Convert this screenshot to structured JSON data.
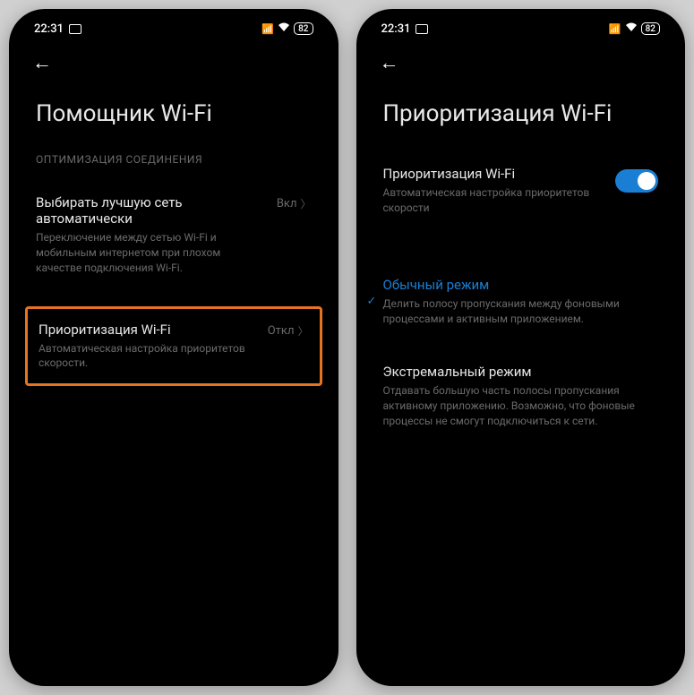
{
  "statusbar": {
    "time": "22:31",
    "battery": "82"
  },
  "left_phone": {
    "title": "Помощник Wi-Fi",
    "section": "ОПТИМИЗАЦИЯ СОЕДИНЕНИЯ",
    "item1": {
      "title": "Выбирать лучшую сеть автоматически",
      "desc": "Переключение между сетью Wi-Fi и мобильным интернетом при плохом качестве подключения Wi-Fi.",
      "value": "Вкл"
    },
    "item2": {
      "title": "Приоритизация Wi-Fi",
      "desc": "Автоматическая настройка приоритетов скорости.",
      "value": "Откл"
    }
  },
  "right_phone": {
    "title": "Приоритизация Wi-Fi",
    "toggle_item": {
      "title": "Приоритизация Wi-Fi",
      "desc": "Автоматическая настройка приоритетов скорости"
    },
    "mode1": {
      "title": "Обычный режим",
      "desc": "Делить полосу пропускания между фоновыми процессами и активным приложением."
    },
    "mode2": {
      "title": "Экстремальный режим",
      "desc": "Отдавать большую часть полосы пропускания активному приложению. Возможно, что фоновые процессы не смогут подключиться к сети."
    }
  }
}
